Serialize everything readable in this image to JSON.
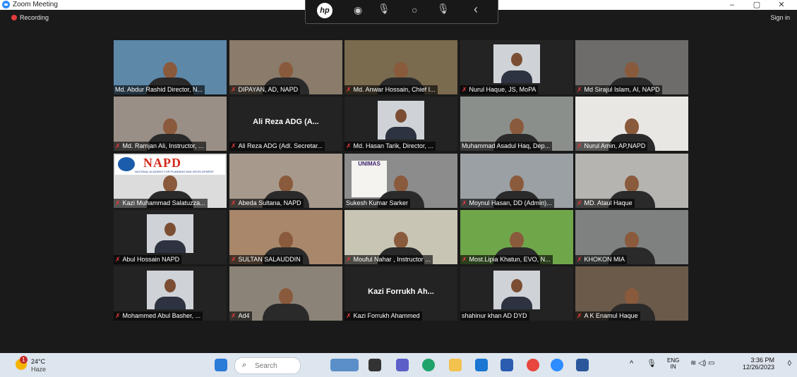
{
  "window": {
    "title": "Zoom Meeting",
    "controls": [
      "–",
      "▢",
      "✕"
    ]
  },
  "meeting": {
    "recording_label": "Recording",
    "signin_label": "Sign in"
  },
  "hp_toolbar": {
    "logo_text": "hp"
  },
  "participants": [
    {
      "name": "Md. Abdur Rashid Director, N...",
      "muted": false,
      "kind": "video",
      "bg": "#5d88a8"
    },
    {
      "name": "DIPAYAN, AD, NAPD",
      "muted": true,
      "kind": "video",
      "bg": "#8a7b6a"
    },
    {
      "name": "Md. Anwar Hossain, Chief I...",
      "muted": true,
      "kind": "video",
      "bg": "#7a6a4e"
    },
    {
      "name": "Nurul Haque, JS, MoPA",
      "muted": true,
      "kind": "photo",
      "bg": "#232323"
    },
    {
      "name": "Md Sirajul Islam, AI, NAPD",
      "muted": true,
      "kind": "video",
      "bg": "#6d6c6a"
    },
    {
      "name": "Md. Ramjan Ali, Instructor, ...",
      "muted": true,
      "kind": "video",
      "bg": "#9a8f86"
    },
    {
      "name": "Ali Reza ADG (Adl. Secretar...",
      "muted": true,
      "kind": "name",
      "display": "Ali Reza ADG (A...",
      "bg": "#232323"
    },
    {
      "name": "Md. Hasan Tarik, Director, ...",
      "muted": true,
      "kind": "photo",
      "bg": "#232323"
    },
    {
      "name": "Muhammad Asadul Haq, Dep...",
      "muted": false,
      "kind": "video",
      "bg": "#8b8f8c",
      "active": true
    },
    {
      "name": "Nurul Amin, AP,NAPD",
      "muted": true,
      "kind": "video",
      "bg": "#e9e7e4"
    },
    {
      "name": "Kazi Muhammad Salatuzza...",
      "muted": true,
      "kind": "napd",
      "bg": "#dcdcdc"
    },
    {
      "name": "Abeda Sultana, NAPD",
      "muted": true,
      "kind": "video",
      "bg": "#a79a8c"
    },
    {
      "name": "Sukesh Kumar Sarker",
      "muted": false,
      "kind": "unimas",
      "bg": "#8c8c8c"
    },
    {
      "name": "Moynul Hasan, DD (Admin)...",
      "muted": true,
      "kind": "video",
      "bg": "#9aa0a3"
    },
    {
      "name": "MD. Ataul Haque",
      "muted": true,
      "kind": "video",
      "bg": "#b5b4b0"
    },
    {
      "name": "Abul Hossain NAPD",
      "muted": true,
      "kind": "photo",
      "bg": "#232323"
    },
    {
      "name": "SULTAN SALAUDDIN",
      "muted": true,
      "kind": "video",
      "bg": "#a8876b"
    },
    {
      "name": "Mouful Nahar , Instructor ...",
      "muted": true,
      "kind": "video",
      "bg": "#c9c5b4"
    },
    {
      "name": "Most.Lipia Khatun, EVO, N...",
      "muted": true,
      "kind": "video",
      "bg": "#6fa64a"
    },
    {
      "name": "KHOKON MIA",
      "muted": true,
      "kind": "video",
      "bg": "#7f8080"
    },
    {
      "name": "Mohammed Abul Basher, ...",
      "muted": true,
      "kind": "photo",
      "bg": "#232323"
    },
    {
      "name": "Ad4",
      "muted": true,
      "kind": "video",
      "bg": "#8c8378"
    },
    {
      "name": "Kazi Forrukh Ahammed",
      "muted": true,
      "kind": "name",
      "display": "Kazi Forrukh Ah...",
      "bg": "#232323"
    },
    {
      "name": "shahinur khan AD DYD",
      "muted": false,
      "kind": "photo",
      "bg": "#232323"
    },
    {
      "name": "A K Enamul Haque",
      "muted": true,
      "kind": "video",
      "bg": "#6b5a4a"
    }
  ],
  "napd_logo": {
    "title": "NAPD",
    "subtitle": "NATIONAL ACADEMY FOR PLANNING AND DEVELOPMENT"
  },
  "unimas_text": "UNIMAS",
  "taskbar": {
    "weather": {
      "badge": "1",
      "temp": "24°C",
      "condition": "Haze"
    },
    "search_placeholder": "Search",
    "lang": "ENG",
    "region": "IN",
    "time": "3:36 PM",
    "date": "12/26/2023"
  }
}
